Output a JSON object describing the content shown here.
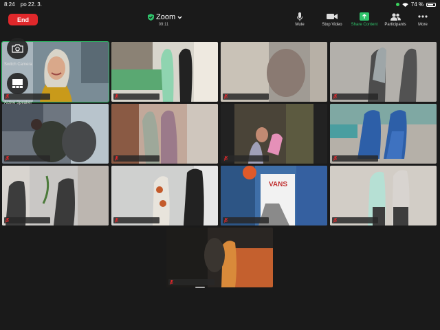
{
  "status_bar": {
    "time": "8:24",
    "date": "po 22. 3.",
    "battery": "74 %",
    "battery_level": 0.74
  },
  "header": {
    "end_label": "End",
    "title": "Zoom",
    "timer": "09:11"
  },
  "toolbar": [
    {
      "label": "Mute",
      "icon": "microphone-icon"
    },
    {
      "label": "Stop Video",
      "icon": "video-camera-icon"
    },
    {
      "label": "Share Content",
      "icon": "share-screen-icon"
    },
    {
      "label": "Participants",
      "icon": "participants-icon"
    },
    {
      "label": "More",
      "icon": "more-dots-icon"
    }
  ],
  "overlay": {
    "switch_camera_label": "Switch Camera",
    "active_speaker_label": "Active Speaker"
  },
  "colors": {
    "accent_green": "#2fc26a",
    "end_red": "#e0282b",
    "muted_mic": "#e0282b"
  },
  "video_tiles": [
    {
      "content": "woman-webcam",
      "active": true
    },
    {
      "content": "socks-green-black"
    },
    {
      "content": "blurred-child"
    },
    {
      "content": "socks-grey-patterned"
    },
    {
      "content": "socks-dark-feet-room"
    },
    {
      "content": "socks-mauve"
    },
    {
      "content": "child-socks-pink"
    },
    {
      "content": "socks-blue"
    },
    {
      "content": "socks-dark-patterned"
    },
    {
      "content": "socks-orange-pattern-black"
    },
    {
      "content": "child-vans-shirt"
    },
    {
      "content": "socks-light-animal"
    },
    {
      "content": "socks-orange-dark-room"
    }
  ],
  "vans_text": "VANS"
}
